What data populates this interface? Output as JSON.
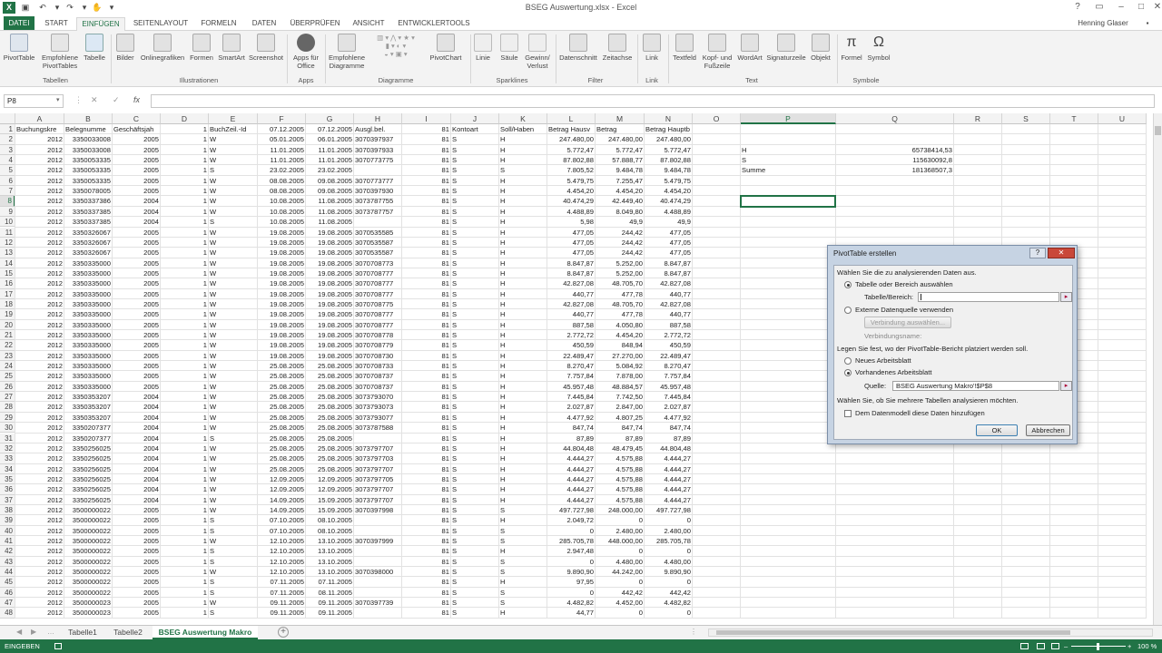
{
  "window": {
    "title": "BSEG Auswertung.xlsx - Excel",
    "user": "Henning Glaser",
    "accent": "#217346"
  },
  "ribbon_tabs": [
    "DATEI",
    "START",
    "EINFÜGEN",
    "SEITENLAYOUT",
    "FORMELN",
    "DATEN",
    "ÜBERPRÜFEN",
    "ANSICHT",
    "ENTWICKLERTOOLS"
  ],
  "ribbon": {
    "tabellen": {
      "pivottable": "PivotTable",
      "empfohlene": "Empfohlene PivotTables",
      "tabelle": "Tabelle",
      "group": "Tabellen"
    },
    "illustrationen": {
      "bilder": "Bilder",
      "online": "Onlinegrafiken",
      "formen": "Formen",
      "smartart": "SmartArt",
      "screenshot": "Screenshot",
      "group": "Illustrationen"
    },
    "apps": {
      "apps": "Apps für Office",
      "group": "Apps"
    },
    "diagramme": {
      "empfohlene": "Empfohlene Diagramme",
      "pivotchart": "PivotChart",
      "group": "Diagramme"
    },
    "sparklines": {
      "linie": "Linie",
      "saule": "Säule",
      "gewinn": "Gewinn/ Verlust",
      "group": "Sparklines"
    },
    "filter": {
      "datenschnitt": "Datenschnitt",
      "zeitachse": "Zeitachse",
      "group": "Filter"
    },
    "link": {
      "link": "Link",
      "group": "Link"
    },
    "text": {
      "textfeld": "Textfeld",
      "kopf": "Kopf- und Fußzeile",
      "wordart": "WordArt",
      "signatur": "Signaturzeile",
      "objekt": "Objekt",
      "group": "Text"
    },
    "symbole": {
      "formel": "Formel",
      "symbol": "Symbol",
      "group": "Symbole"
    }
  },
  "formula_bar": {
    "name_box": "P8",
    "fx": "fx",
    "value": ""
  },
  "columns": [
    "A",
    "B",
    "C",
    "D",
    "E",
    "F",
    "G",
    "H",
    "I",
    "J",
    "K",
    "L",
    "M",
    "N",
    "O",
    "P",
    "Q",
    "R",
    "S",
    "T",
    "U"
  ],
  "headers": [
    "Buchungskre",
    "Belegnumme",
    "Geschäftsjah",
    "1",
    "BuchZeil.-Id",
    "07.12.2005",
    "07.12.2005",
    "Ausgl.bel.",
    "81",
    "Kontoart",
    "Soll/Haben",
    "Betrag Hausv",
    "Betrag",
    "Betrag Hauptb"
  ],
  "rows": [
    [
      "2012",
      "3350033008",
      "2005",
      "1",
      "W",
      "05.01.2005",
      "06.01.2005",
      "3070397937",
      "81",
      "S",
      "H",
      "247.480,00",
      "247.480,00",
      "247.480,00"
    ],
    [
      "2012",
      "3350033008",
      "2005",
      "1",
      "W",
      "11.01.2005",
      "11.01.2005",
      "3070397933",
      "81",
      "S",
      "H",
      "5.772,47",
      "5.772,47",
      "5.772,47"
    ],
    [
      "2012",
      "3350053335",
      "2005",
      "1",
      "W",
      "11.01.2005",
      "11.01.2005",
      "3070773775",
      "81",
      "S",
      "H",
      "87.802,88",
      "57.888,77",
      "87.802,88"
    ],
    [
      "2012",
      "3350053335",
      "2005",
      "1",
      "S",
      "23.02.2005",
      "23.02.2005",
      "",
      "81",
      "S",
      "S",
      "7.805,52",
      "9.484,78",
      "9.484,78"
    ],
    [
      "2012",
      "3350053335",
      "2005",
      "1",
      "W",
      "08.08.2005",
      "09.08.2005",
      "3070773777",
      "81",
      "S",
      "H",
      "5.479,75",
      "7.255,47",
      "5.479,75"
    ],
    [
      "2012",
      "3350078005",
      "2005",
      "1",
      "W",
      "08.08.2005",
      "09.08.2005",
      "3070397930",
      "81",
      "S",
      "H",
      "4.454,20",
      "4.454,20",
      "4.454,20"
    ],
    [
      "2012",
      "3350337386",
      "2004",
      "1",
      "W",
      "10.08.2005",
      "11.08.2005",
      "3073787755",
      "81",
      "S",
      "H",
      "40.474,29",
      "42.449,40",
      "40.474,29"
    ],
    [
      "2012",
      "3350337385",
      "2004",
      "1",
      "W",
      "10.08.2005",
      "11.08.2005",
      "3073787757",
      "81",
      "S",
      "H",
      "4.488,89",
      "8.049,80",
      "4.488,89"
    ],
    [
      "2012",
      "3350337385",
      "2004",
      "1",
      "S",
      "10.08.2005",
      "11.08.2005",
      "",
      "81",
      "S",
      "H",
      "5,98",
      "49,9",
      "49,9"
    ],
    [
      "2012",
      "3350326067",
      "2005",
      "1",
      "W",
      "19.08.2005",
      "19.08.2005",
      "3070535585",
      "81",
      "S",
      "H",
      "477,05",
      "244,42",
      "477,05"
    ],
    [
      "2012",
      "3350326067",
      "2005",
      "1",
      "W",
      "19.08.2005",
      "19.08.2005",
      "3070535587",
      "81",
      "S",
      "H",
      "477,05",
      "244,42",
      "477,05"
    ],
    [
      "2012",
      "3350326067",
      "2005",
      "1",
      "W",
      "19.08.2005",
      "19.08.2005",
      "3070535587",
      "81",
      "S",
      "H",
      "477,05",
      "244,42",
      "477,05"
    ],
    [
      "2012",
      "3350335000",
      "2005",
      "1",
      "W",
      "19.08.2005",
      "19.08.2005",
      "3070708773",
      "81",
      "S",
      "H",
      "8.847,87",
      "5.252,00",
      "8.847,87"
    ],
    [
      "2012",
      "3350335000",
      "2005",
      "1",
      "W",
      "19.08.2005",
      "19.08.2005",
      "3070708777",
      "81",
      "S",
      "H",
      "8.847,87",
      "5.252,00",
      "8.847,87"
    ],
    [
      "2012",
      "3350335000",
      "2005",
      "1",
      "W",
      "19.08.2005",
      "19.08.2005",
      "3070708777",
      "81",
      "S",
      "H",
      "42.827,08",
      "48.705,70",
      "42.827,08"
    ],
    [
      "2012",
      "3350335000",
      "2005",
      "1",
      "W",
      "19.08.2005",
      "19.08.2005",
      "3070708777",
      "81",
      "S",
      "H",
      "440,77",
      "477,78",
      "440,77"
    ],
    [
      "2012",
      "3350335000",
      "2005",
      "1",
      "W",
      "19.08.2005",
      "19.08.2005",
      "3070708775",
      "81",
      "S",
      "H",
      "42.827,08",
      "48.705,70",
      "42.827,08"
    ],
    [
      "2012",
      "3350335000",
      "2005",
      "1",
      "W",
      "19.08.2005",
      "19.08.2005",
      "3070708777",
      "81",
      "S",
      "H",
      "440,77",
      "477,78",
      "440,77"
    ],
    [
      "2012",
      "3350335000",
      "2005",
      "1",
      "W",
      "19.08.2005",
      "19.08.2005",
      "3070708777",
      "81",
      "S",
      "H",
      "887,58",
      "4.050,80",
      "887,58"
    ],
    [
      "2012",
      "3350335000",
      "2005",
      "1",
      "W",
      "19.08.2005",
      "19.08.2005",
      "3070708778",
      "81",
      "S",
      "H",
      "2.772,72",
      "4.454,20",
      "2.772,72"
    ],
    [
      "2012",
      "3350335000",
      "2005",
      "1",
      "W",
      "19.08.2005",
      "19.08.2005",
      "3070708779",
      "81",
      "S",
      "H",
      "450,59",
      "848,94",
      "450,59"
    ],
    [
      "2012",
      "3350335000",
      "2005",
      "1",
      "W",
      "19.08.2005",
      "19.08.2005",
      "3070708730",
      "81",
      "S",
      "H",
      "22.489,47",
      "27.270,00",
      "22.489,47"
    ],
    [
      "2012",
      "3350335000",
      "2005",
      "1",
      "W",
      "25.08.2005",
      "25.08.2005",
      "3070708733",
      "81",
      "S",
      "H",
      "8.270,47",
      "5.084,92",
      "8.270,47"
    ],
    [
      "2012",
      "3350335000",
      "2005",
      "1",
      "W",
      "25.08.2005",
      "25.08.2005",
      "3070708737",
      "81",
      "S",
      "H",
      "7.757,84",
      "7.878,00",
      "7.757,84"
    ],
    [
      "2012",
      "3350335000",
      "2005",
      "1",
      "W",
      "25.08.2005",
      "25.08.2005",
      "3070708737",
      "81",
      "S",
      "H",
      "45.957,48",
      "48.884,57",
      "45.957,48"
    ],
    [
      "2012",
      "3350353207",
      "2004",
      "1",
      "W",
      "25.08.2005",
      "25.08.2005",
      "3073793070",
      "81",
      "S",
      "H",
      "7.445,84",
      "7.742,50",
      "7.445,84"
    ],
    [
      "2012",
      "3350353207",
      "2004",
      "1",
      "W",
      "25.08.2005",
      "25.08.2005",
      "3073793073",
      "81",
      "S",
      "H",
      "2.027,87",
      "2.847,00",
      "2.027,87"
    ],
    [
      "2012",
      "3350353207",
      "2004",
      "1",
      "W",
      "25.08.2005",
      "25.08.2005",
      "3073793077",
      "81",
      "S",
      "H",
      "4.477,92",
      "4.807,25",
      "4.477,92"
    ],
    [
      "2012",
      "3350207377",
      "2004",
      "1",
      "W",
      "25.08.2005",
      "25.08.2005",
      "3073787588",
      "81",
      "S",
      "H",
      "847,74",
      "847,74",
      "847,74"
    ],
    [
      "2012",
      "3350207377",
      "2004",
      "1",
      "S",
      "25.08.2005",
      "25.08.2005",
      "",
      "81",
      "S",
      "H",
      "87,89",
      "87,89",
      "87,89"
    ],
    [
      "2012",
      "3350256025",
      "2004",
      "1",
      "W",
      "25.08.2005",
      "25.08.2005",
      "3073797707",
      "81",
      "S",
      "H",
      "44.804,48",
      "48.479,45",
      "44.804,48"
    ],
    [
      "2012",
      "3350256025",
      "2004",
      "1",
      "W",
      "25.08.2005",
      "25.08.2005",
      "3073797703",
      "81",
      "S",
      "H",
      "4.444,27",
      "4.575,88",
      "4.444,27"
    ],
    [
      "2012",
      "3350256025",
      "2004",
      "1",
      "W",
      "25.08.2005",
      "25.08.2005",
      "3073797707",
      "81",
      "S",
      "H",
      "4.444,27",
      "4.575,88",
      "4.444,27"
    ],
    [
      "2012",
      "3350256025",
      "2004",
      "1",
      "W",
      "12.09.2005",
      "12.09.2005",
      "3073797705",
      "81",
      "S",
      "H",
      "4.444,27",
      "4.575,88",
      "4.444,27"
    ],
    [
      "2012",
      "3350256025",
      "2004",
      "1",
      "W",
      "12.09.2005",
      "12.09.2005",
      "3073797707",
      "81",
      "S",
      "H",
      "4.444,27",
      "4.575,88",
      "4.444,27"
    ],
    [
      "2012",
      "3350256025",
      "2004",
      "1",
      "W",
      "14.09.2005",
      "15.09.2005",
      "3073797707",
      "81",
      "S",
      "H",
      "4.444,27",
      "4.575,88",
      "4.444,27"
    ],
    [
      "2012",
      "3500000022",
      "2005",
      "1",
      "W",
      "14.09.2005",
      "15.09.2005",
      "3070397998",
      "81",
      "S",
      "S",
      "497.727,98",
      "248.000,00",
      "497.727,98"
    ],
    [
      "2012",
      "3500000022",
      "2005",
      "1",
      "S",
      "07.10.2005",
      "08.10.2005",
      "",
      "81",
      "S",
      "H",
      "2.049,72",
      "0",
      "0"
    ],
    [
      "2012",
      "3500000022",
      "2005",
      "1",
      "S",
      "07.10.2005",
      "08.10.2005",
      "",
      "81",
      "S",
      "S",
      "0",
      "2.480,00",
      "2.480,00"
    ],
    [
      "2012",
      "3500000022",
      "2005",
      "1",
      "W",
      "12.10.2005",
      "13.10.2005",
      "3070397999",
      "81",
      "S",
      "S",
      "285.705,78",
      "448.000,00",
      "285.705,78"
    ],
    [
      "2012",
      "3500000022",
      "2005",
      "1",
      "S",
      "12.10.2005",
      "13.10.2005",
      "",
      "81",
      "S",
      "H",
      "2.947,48",
      "0",
      "0"
    ],
    [
      "2012",
      "3500000022",
      "2005",
      "1",
      "S",
      "12.10.2005",
      "13.10.2005",
      "",
      "81",
      "S",
      "S",
      "0",
      "4.480,00",
      "4.480,00"
    ],
    [
      "2012",
      "3500000022",
      "2005",
      "1",
      "W",
      "12.10.2005",
      "13.10.2005",
      "3070398000",
      "81",
      "S",
      "S",
      "9.890,90",
      "44.242,00",
      "9.890,90"
    ],
    [
      "2012",
      "3500000022",
      "2005",
      "1",
      "S",
      "07.11.2005",
      "07.11.2005",
      "",
      "81",
      "S",
      "H",
      "97,95",
      "0",
      "0"
    ],
    [
      "2012",
      "3500000022",
      "2005",
      "1",
      "S",
      "07.11.2005",
      "08.11.2005",
      "",
      "81",
      "S",
      "S",
      "0",
      "442,42",
      "442,42"
    ],
    [
      "2012",
      "3500000023",
      "2005",
      "1",
      "W",
      "09.11.2005",
      "09.11.2005",
      "3070397739",
      "81",
      "S",
      "S",
      "4.482,82",
      "4.452,00",
      "4.482,82"
    ],
    [
      "2012",
      "3500000023",
      "2005",
      "1",
      "S",
      "09.11.2005",
      "09.11.2005",
      "",
      "81",
      "S",
      "H",
      "44,77",
      "0",
      "0"
    ]
  ],
  "summary": [
    {
      "label": "H",
      "value": "65738414,53"
    },
    {
      "label": "S",
      "value": "115630092,8"
    },
    {
      "label": "Summe",
      "value": "181368507,3"
    }
  ],
  "sheets": [
    "Tabelle1",
    "Tabelle2",
    "BSEG Auswertung Makro"
  ],
  "status": {
    "mode": "EINGEBEN",
    "zoom": "100 %"
  },
  "dialog": {
    "title": "PivotTable erstellen",
    "help": "?",
    "section1": "Wählen Sie die zu analysierenden Daten aus.",
    "opt_range": "Tabelle oder Bereich auswählen",
    "range_label": "Tabelle/Bereich:",
    "range_value": "",
    "opt_external": "Externe Datenquelle verwenden",
    "conn_button": "Verbindung auswählen...",
    "conn_label": "Verbindungsname:",
    "section2": "Legen Sie fest, wo der PivotTable-Bericht platziert werden soll.",
    "opt_new": "Neues Arbeitsblatt",
    "opt_existing": "Vorhandenes Arbeitsblatt",
    "source_label": "Quelle:",
    "source_value": "BSEG Auswertung Makro'!$P$8",
    "section3": "Wählen Sie, ob Sie mehrere Tabellen analysieren möchten.",
    "datamodel": "Dem Datenmodell diese Daten hinzufügen",
    "ok": "OK",
    "cancel": "Abbrechen"
  }
}
